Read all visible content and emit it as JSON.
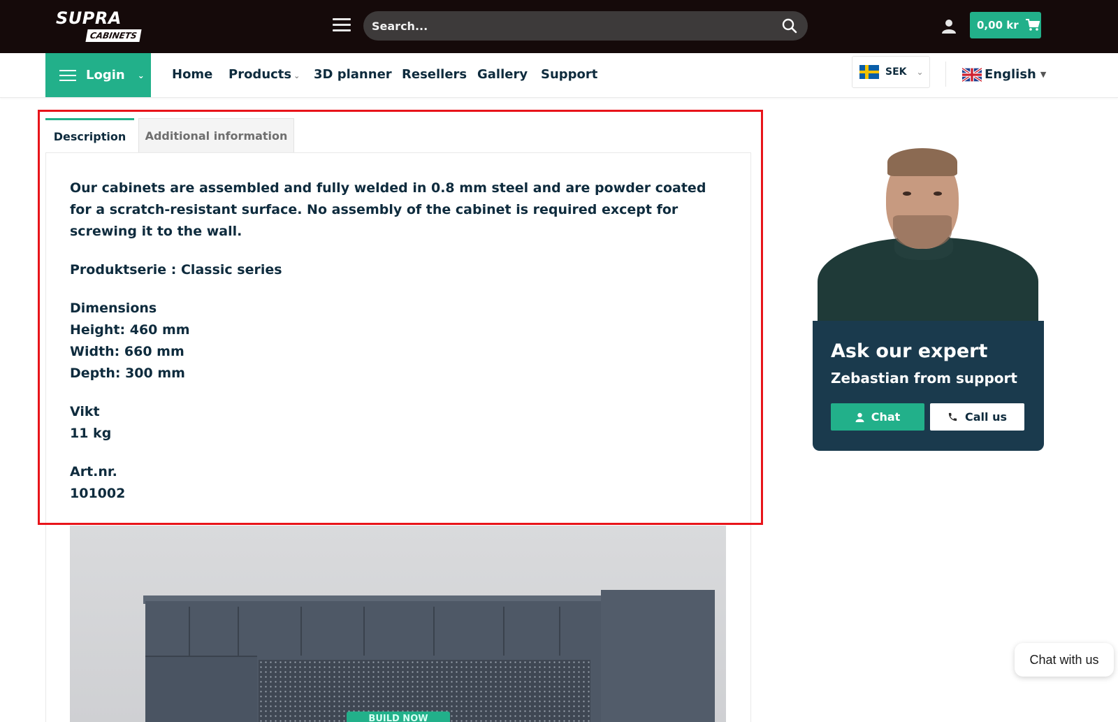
{
  "header": {
    "logo_primary": "SUPRA",
    "logo_secondary": "CABINETS",
    "search_placeholder": "Search...",
    "cart_amount": "0,00 kr"
  },
  "nav": {
    "login_label": "Login",
    "items": [
      {
        "label": "Home"
      },
      {
        "label": "Products"
      },
      {
        "label": "3D planner"
      },
      {
        "label": "Resellers"
      },
      {
        "label": "Gallery"
      },
      {
        "label": "Support"
      }
    ],
    "currency": "SEK",
    "language": "English"
  },
  "tabs": {
    "description": "Description",
    "additional": "Additional information"
  },
  "description": {
    "intro": "Our cabinets are assembled and fully welded in 0.8 mm steel and are powder coated for a scratch-resistant surface. No assembly of the cabinet is required except for screwing it to the wall.",
    "series": "Produktserie : Classic series",
    "dimensions_heading": "Dimensions",
    "height": "Height: 460 mm",
    "width": "Width: 660 mm",
    "depth": "Depth: 300 mm",
    "weight_heading": "Vikt",
    "weight_value": "11 kg",
    "artnr_heading": "Art.nr.",
    "artnr_value": "101002"
  },
  "product_image": {
    "button_label": "BUILD NOW"
  },
  "expert": {
    "title": "Ask our expert",
    "subtitle": "Zebastian from support",
    "chat_label": "Chat",
    "call_label": "Call us"
  },
  "chat_widget": {
    "label": "Chat with us"
  },
  "colors": {
    "brand_green": "#22b08a",
    "topbar_bg": "#150a0a",
    "expert_card_bg": "#1a3a4d",
    "highlight_border": "#e8141a",
    "text_dark": "#0e2b3d"
  }
}
